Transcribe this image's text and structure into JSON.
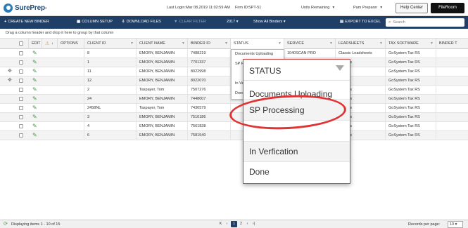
{
  "app": {
    "logo": "SurePrep",
    "last_login_label": "Last Login:",
    "last_login_value": "Mar 08,2019 11:02:59 AM",
    "firm_label": "Firm ID:",
    "firm_value": "SPT-51",
    "units_label": "Units Remaining",
    "user_label": "Pam Preparer",
    "help_label": "Help Center",
    "fileroom_label": "FileRoom"
  },
  "toolbar": {
    "create": "Create New Binder",
    "column_setup": "Column Setup",
    "download": "Download Files",
    "clear_filter": "Clear Filter",
    "year": "2017",
    "show": "Show All Binders",
    "export": "Export to Excel",
    "search_placeholder": "Search"
  },
  "group_hint": "Drag a column header and drop it here to group by that column",
  "columns": [
    "Edit",
    "Options",
    "Client ID",
    "Client Name",
    "Binder ID",
    "Status",
    "Service",
    "Leadsheets",
    "Tax Software",
    "Binder T"
  ],
  "rows": [
    {
      "client_id": "8",
      "client_name": "EMORY, BENJAMIN",
      "binder_id": "7488219",
      "status": "",
      "service": "1040SCAN PRO",
      "leadsheets": "Classic Leadsheets",
      "tax_software": "GoSystem Tax RS",
      "move": ""
    },
    {
      "client_id": "1",
      "client_name": "EMORY, BENJAMIN",
      "binder_id": "7701337",
      "status": "",
      "service": "",
      "leadsheets": "ssheets",
      "tax_software": "GoSystem Tax RS",
      "move": ""
    },
    {
      "client_id": "11",
      "client_name": "EMORY, BENJAMIN",
      "binder_id": "8022998",
      "status": "",
      "service": "",
      "leadsheets": "",
      "tax_software": "GoSystem Tax RS",
      "move": "✥"
    },
    {
      "client_id": "12",
      "client_name": "EMORY, BENJAMIN",
      "binder_id": "8022070",
      "status": "",
      "service": "",
      "leadsheets": "",
      "tax_software": "GoSystem Tax RS",
      "move": "✥"
    },
    {
      "client_id": "2",
      "client_name": "Taxpayer, Tom",
      "binder_id": "7507276",
      "status": "",
      "service": "",
      "leadsheets": "ssheets",
      "tax_software": "GoSystem Tax RS",
      "move": ""
    },
    {
      "client_id": "24",
      "client_name": "EMORY, BENJAMIN",
      "binder_id": "7448007",
      "status": "",
      "service": "",
      "leadsheets": "ssheets",
      "tax_software": "GoSystem Tax RS",
      "move": ""
    },
    {
      "client_id": "2458NL",
      "client_name": "Taxpayer, Tom",
      "binder_id": "7430579",
      "status": "",
      "service": "",
      "leadsheets": "ssheets",
      "tax_software": "GoSystem Tax RS",
      "move": ""
    },
    {
      "client_id": "3",
      "client_name": "EMORY, BENJAMIN",
      "binder_id": "7510186",
      "status": "",
      "service": "",
      "leadsheets": "ssheets",
      "tax_software": "GoSystem Tax RS",
      "move": ""
    },
    {
      "client_id": "4",
      "client_name": "EMORY, BENJAMIN",
      "binder_id": "7561838",
      "status": "",
      "service": "",
      "leadsheets": "ssheets",
      "tax_software": "GoSystem Tax RS",
      "move": ""
    },
    {
      "client_id": "6",
      "client_name": "EMORY, BENJAMIN",
      "binder_id": "7581540",
      "status": "",
      "service": "",
      "leadsheets": "ssheets",
      "tax_software": "GoSystem Tax RS",
      "move": ""
    }
  ],
  "status_dropdown": {
    "options": [
      "Documents Uploading",
      "SP P",
      "In Ve",
      "Done"
    ]
  },
  "zoom_popup": {
    "title": "STATUS",
    "options": [
      "Documents Uploading",
      "SP Processing",
      "",
      "In Verfication",
      "Done"
    ]
  },
  "footer": {
    "displaying": "Displaying items 1 - 10 of 15",
    "first": "K",
    "prev": "‹",
    "page1": "1",
    "page2": "2",
    "next": "›",
    "last": "›|",
    "records_label": "Records per page:",
    "records_value": "10"
  },
  "colors": {
    "toolbar": "#1f3f66",
    "pencil": "#3d9a3d",
    "highlight": "#e03333"
  }
}
